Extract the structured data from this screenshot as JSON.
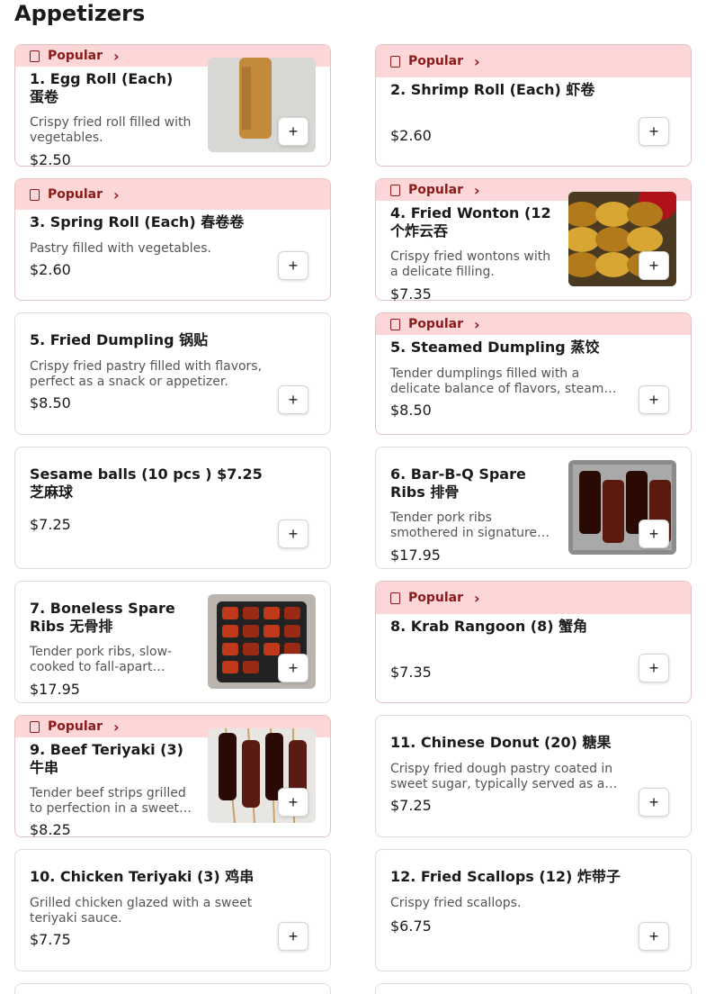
{
  "section": {
    "title": "Appetizers"
  },
  "popular_label": "Popular",
  "add_label": "+",
  "items": [
    {
      "name": "1. Egg Roll (Each) 蛋卷",
      "desc": "Crispy fried roll filled with vegetables.",
      "price": "$2.50",
      "popular": true,
      "image": "egg-roll"
    },
    {
      "name": "2. Shrimp Roll (Each) 虾卷",
      "desc": "",
      "price": "$2.60",
      "popular": true,
      "image": ""
    },
    {
      "name": "3. Spring Roll (Each) 春卷卷",
      "desc": "Pastry filled with vegetables.",
      "price": "$2.60",
      "popular": true,
      "image": ""
    },
    {
      "name": "4. Fried Wonton (12个炸云吞",
      "desc": "Crispy fried wontons with a delicate filling.",
      "price": "$7.35",
      "popular": true,
      "image": "fried-wonton"
    },
    {
      "name": "5. Fried Dumpling 锅贴",
      "desc": "Crispy fried pastry filled with flavors, perfect as a snack or appetizer.",
      "price": "$8.50",
      "popular": false,
      "image": ""
    },
    {
      "name": "5. Steamed Dumpling 蒸饺",
      "desc": "Tender dumplings filled with a delicate balance of flavors, steamed to perfection.",
      "price": "$8.50",
      "popular": true,
      "image": ""
    },
    {
      "name": "Sesame balls (10 pcs ) $7.25 芝麻球",
      "desc": "",
      "price": "$7.25",
      "popular": false,
      "image": ""
    },
    {
      "name": "6. Bar-B-Q Spare Ribs 排骨",
      "desc": "Tender pork ribs smothered in signature barbecue sauce.",
      "price": "$17.95",
      "popular": false,
      "image": "spare-ribs"
    },
    {
      "name": "7. Boneless Spare Ribs 无骨排",
      "desc": "Tender pork ribs, slow-cooked to fall-apart perfection.",
      "price": "$17.95",
      "popular": false,
      "image": "boneless-ribs"
    },
    {
      "name": "8. Krab Rangoon (8) 蟹角",
      "desc": "",
      "price": "$7.35",
      "popular": true,
      "image": ""
    },
    {
      "name": "9. Beef Teriyaki (3) 牛串",
      "desc": "Tender beef strips grilled to perfection in a sweet teriyaki glaze.",
      "price": "$8.25",
      "popular": true,
      "image": "beef-teriyaki"
    },
    {
      "name": "11. Chinese Donut (20) 糖果",
      "desc": "Crispy fried dough pastry coated in sweet sugar, typically served as a snack.",
      "price": "$7.25",
      "popular": false,
      "image": ""
    },
    {
      "name": "10. Chicken Teriyaki (3) 鸡串",
      "desc": "Grilled chicken glazed with a sweet teriyaki sauce.",
      "price": "$7.75",
      "popular": false,
      "image": ""
    },
    {
      "name": "12. Fried Scallops (12) 炸带子",
      "desc": "Crispy fried scallops.",
      "price": "$6.75",
      "popular": false,
      "image": ""
    }
  ],
  "colors": {
    "popular_bg": "#fdd7d7",
    "popular_text": "#8b1a1a",
    "border": "#dcdcdc"
  }
}
